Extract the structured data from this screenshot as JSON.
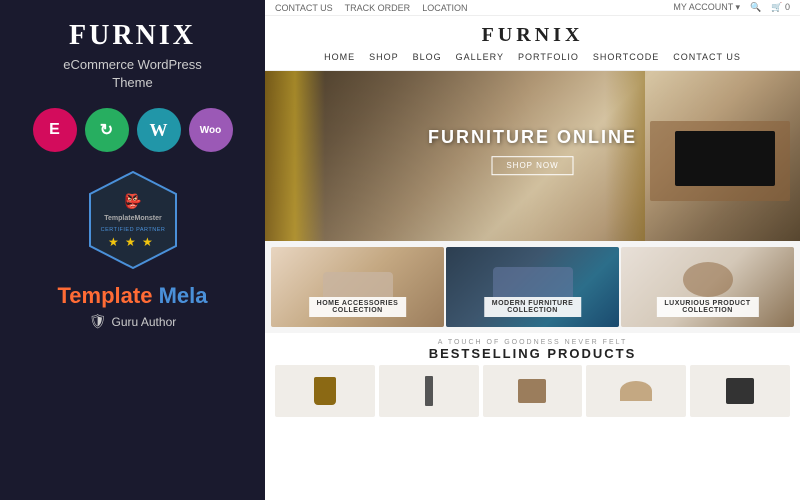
{
  "left": {
    "logo": "FURNIX",
    "subtitle": "eCommerce WordPress\nTheme",
    "icons": [
      {
        "id": "elementor",
        "symbol": "E",
        "color": "#d30c5c",
        "label": "elementor-icon"
      },
      {
        "id": "refresh",
        "symbol": "↻",
        "color": "#27ae60",
        "label": "customizer-icon"
      },
      {
        "id": "wordpress",
        "symbol": "W",
        "color": "#2196a8",
        "label": "wordpress-icon"
      },
      {
        "id": "woo",
        "symbol": "Woo",
        "color": "#9b59b6",
        "label": "woocommerce-icon"
      }
    ],
    "badge": {
      "face": "👺",
      "name": "TemplateMonster",
      "certified": "★ CERTIFIED PARTNER ★",
      "stars": "★ ★ ★"
    },
    "brand": {
      "template": "Template",
      "mela": "Mela"
    },
    "guru": {
      "icon": "🛡",
      "label": "Guru Author"
    }
  },
  "right": {
    "topbar": {
      "left_items": [
        "CONTACT US",
        "TRACK ORDER",
        "LOCATION"
      ],
      "right_items": [
        "MY ACCOUNT",
        "🔍",
        "🛒 0"
      ]
    },
    "header": {
      "logo": "FURNIX",
      "nav": [
        "HOME",
        "SHOP",
        "BLOG",
        "GALLERY",
        "PORTFOLIO",
        "SHORTCODE",
        "CONTACT US"
      ]
    },
    "hero": {
      "title": "FURNITURE ONLINE",
      "button": "SHOP NOW"
    },
    "categories": [
      {
        "label": "HOME ACCESSORIES\nCOLLECTION",
        "type": "accessories"
      },
      {
        "label": "MODERN FURNITURE\nCOLLECTION",
        "type": "furniture"
      },
      {
        "label": "LUXURIOUS PRODUCT\nCOLLECTION",
        "type": "luxurious"
      }
    ],
    "bestselling": {
      "subtitle": "A TOUCH OF GOODNESS NEVER FELT",
      "title": "BESTSELLING PRODUCTS"
    },
    "products": [
      {
        "type": "bag",
        "shape": "bag"
      },
      {
        "type": "lamp",
        "shape": "lamp"
      },
      {
        "type": "chair",
        "shape": "chair"
      },
      {
        "type": "stool",
        "shape": "stool"
      },
      {
        "type": "black-chair",
        "shape": "black-chair"
      }
    ]
  }
}
